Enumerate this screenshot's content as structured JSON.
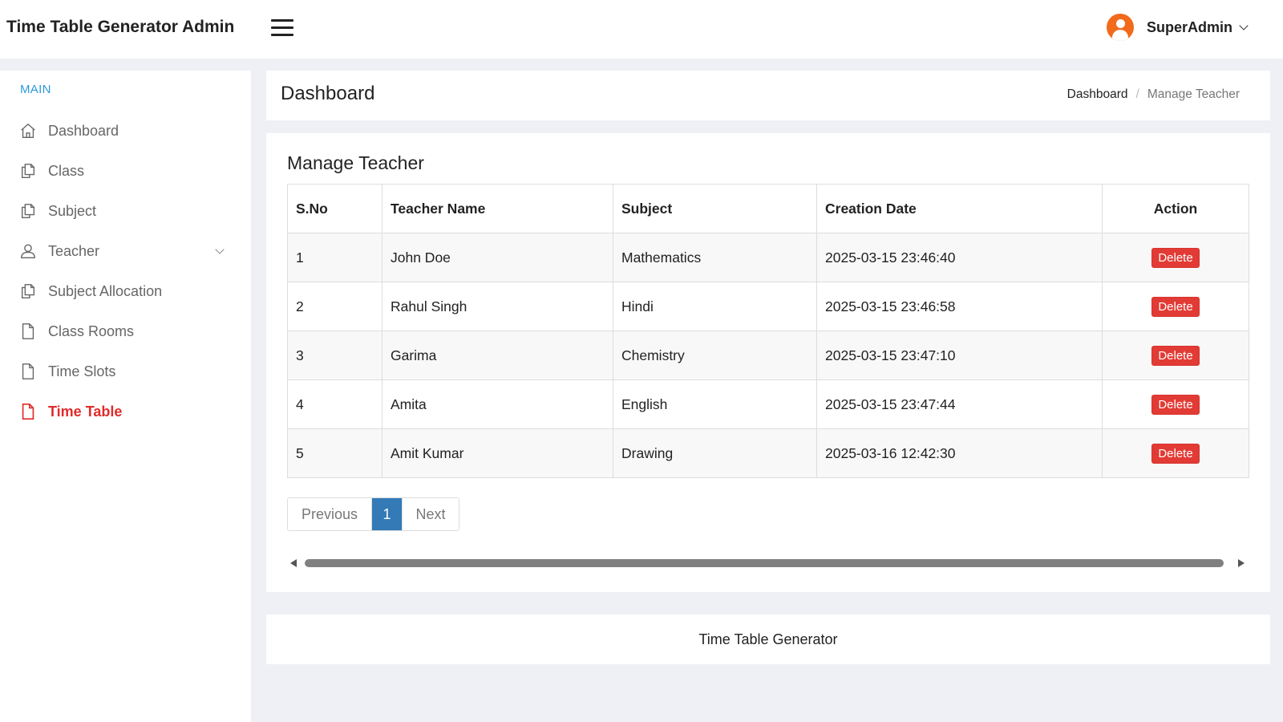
{
  "app": {
    "title": "Time Table Generator Admin"
  },
  "user": {
    "name": "SuperAdmin"
  },
  "sidebar": {
    "heading": "MAIN",
    "items": [
      {
        "label": "Dashboard",
        "icon": "home-icon"
      },
      {
        "label": "Class",
        "icon": "files-icon"
      },
      {
        "label": "Subject",
        "icon": "files-icon"
      },
      {
        "label": "Teacher",
        "icon": "user-icon"
      },
      {
        "label": "Subject Allocation",
        "icon": "files-icon"
      },
      {
        "label": "Class Rooms",
        "icon": "file-icon"
      },
      {
        "label": "Time Slots",
        "icon": "file-icon"
      },
      {
        "label": "Time Table",
        "icon": "file-icon",
        "active": true
      }
    ]
  },
  "header": {
    "title": "Dashboard",
    "breadcrumb": [
      "Dashboard",
      "Manage Teacher"
    ]
  },
  "main": {
    "card_title": "Manage Teacher",
    "columns": [
      "S.No",
      "Teacher Name",
      "Subject",
      "Creation Date",
      "Action"
    ],
    "rows": [
      {
        "sno": "1",
        "name": "John Doe",
        "subject": "Mathematics",
        "date": "2025-03-15 23:46:40",
        "action": "Delete"
      },
      {
        "sno": "2",
        "name": "Rahul Singh",
        "subject": "Hindi",
        "date": "2025-03-15 23:46:58",
        "action": "Delete"
      },
      {
        "sno": "3",
        "name": "Garima",
        "subject": "Chemistry",
        "date": "2025-03-15 23:47:10",
        "action": "Delete"
      },
      {
        "sno": "4",
        "name": "Amita",
        "subject": "English",
        "date": "2025-03-15 23:47:44",
        "action": "Delete"
      },
      {
        "sno": "5",
        "name": "Amit Kumar",
        "subject": "Drawing",
        "date": "2025-03-16 12:42:30",
        "action": "Delete"
      }
    ],
    "pagination": {
      "previous": "Previous",
      "current": "1",
      "next": "Next"
    }
  },
  "footer": {
    "text": "Time Table Generator"
  },
  "colors": {
    "accent": "#e02b2b",
    "link_blue": "#2d9ad8",
    "page_active": "#337ab7",
    "delete": "#e23b35",
    "avatar": "#f26a1b"
  }
}
